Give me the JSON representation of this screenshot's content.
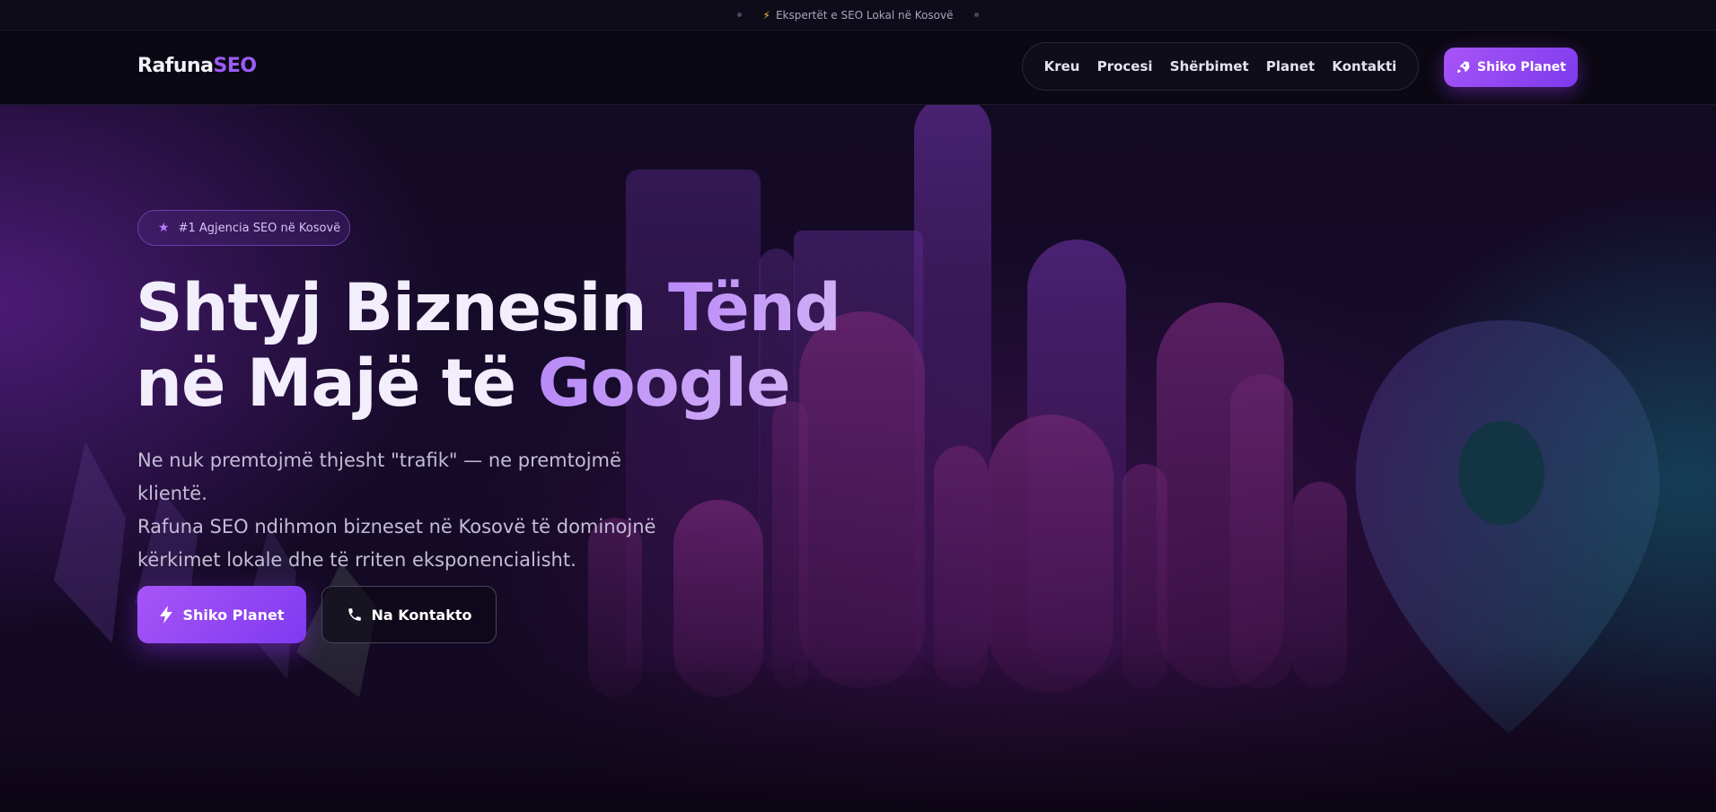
{
  "topbar": {
    "announcement": "Ekspertët e SEO Lokal në Kosovë",
    "bolt_icon": "⚡"
  },
  "nav": {
    "logo_part1": "Rafuna",
    "logo_part2": "SEO",
    "items": [
      {
        "label": "Kreu"
      },
      {
        "label": "Procesi"
      },
      {
        "label": "Shërbimet"
      },
      {
        "label": "Planet"
      },
      {
        "label": "Kontakti"
      }
    ],
    "cta_label": "Shiko Planet",
    "cta_icon": "rocket-icon"
  },
  "hero": {
    "badge": "#1 Agjencia SEO në Kosovë",
    "badge_icon": "star-icon",
    "title_line1_plain": "Shtyj Biznesin ",
    "title_line1_accent": "Tënd",
    "title_line2_plain": "në Majë të ",
    "title_line2_accent": "Google",
    "lead_line1": "Ne nuk premtojmë thjesht \"trafik\" — ne premtojmë klientë.",
    "lead_line2": "Rafuna SEO ndihmon bizneset në Kosovë të dominojnë",
    "lead_line3": "kërkimet lokale dhe të rriten eksponencialisht.",
    "primary_button": "Shiko Planet",
    "primary_icon": "bolt-icon",
    "secondary_button": "Na Kontakto",
    "secondary_icon": "phone-icon"
  },
  "colors": {
    "accent": "#9b5cf6",
    "accent_gradient_start": "#a855f7",
    "accent_gradient_end": "#7c3aed",
    "background": "#0c0915",
    "teal_glow": "#14a0aa"
  }
}
